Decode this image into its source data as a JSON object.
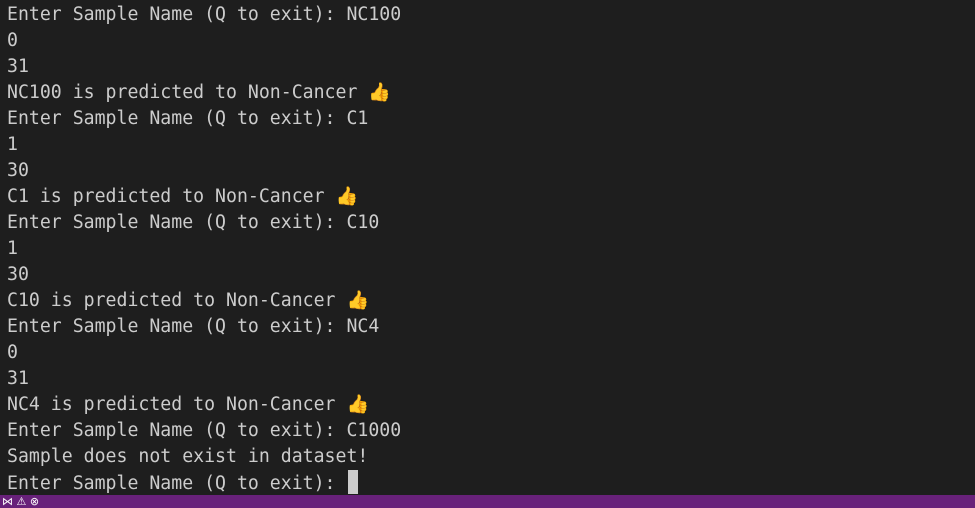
{
  "terminal": {
    "lines": [
      {
        "text": "Enter Sample Name (Q to exit): NC100"
      },
      {
        "text": "0"
      },
      {
        "text": "31"
      },
      {
        "text": "NC100 is predicted to Non-Cancer",
        "emoji": "👍"
      },
      {
        "text": "Enter Sample Name (Q to exit): C1"
      },
      {
        "text": "1"
      },
      {
        "text": "30"
      },
      {
        "text": "C1 is predicted to Non-Cancer",
        "emoji": "👍"
      },
      {
        "text": "Enter Sample Name (Q to exit): C10"
      },
      {
        "text": "1"
      },
      {
        "text": "30"
      },
      {
        "text": "C10 is predicted to Non-Cancer",
        "emoji": "👍"
      },
      {
        "text": "Enter Sample Name (Q to exit): NC4"
      },
      {
        "text": "0"
      },
      {
        "text": "31"
      },
      {
        "text": "NC4 is predicted to Non-Cancer",
        "emoji": "👍"
      },
      {
        "text": "Enter Sample Name (Q to exit): C1000"
      },
      {
        "text": "Sample does not exist in dataset!"
      }
    ],
    "prompt": "Enter Sample Name (Q to exit): "
  },
  "status_bar": {
    "color": "#68217a",
    "icons": [
      "remote-icon",
      "warning-icon",
      "error-icon"
    ]
  }
}
